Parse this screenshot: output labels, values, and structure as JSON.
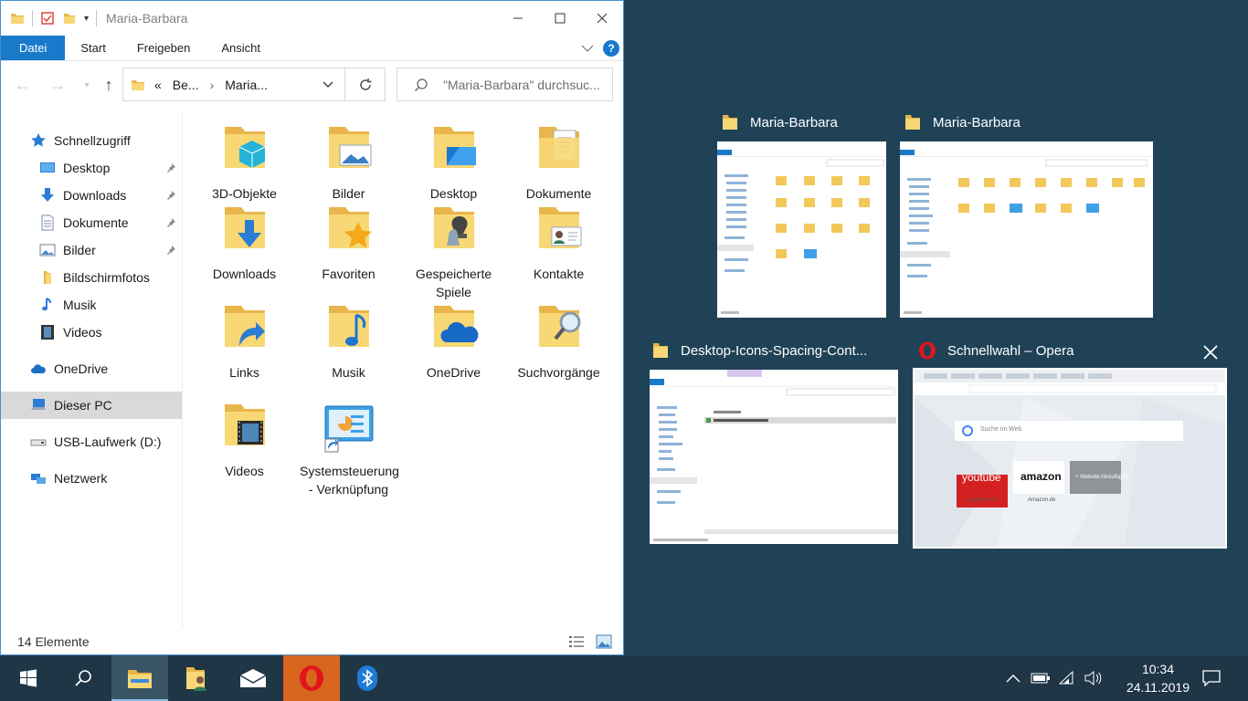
{
  "window": {
    "title": "Maria-Barbara",
    "ribbon_tabs": [
      "Datei",
      "Start",
      "Freigeben",
      "Ansicht"
    ],
    "address": {
      "prefix": "«",
      "crumb1": "Be...",
      "sep": "›",
      "crumb2": "Maria..."
    },
    "search_placeholder": "\"Maria-Barbara\" durchsuc...",
    "status": "14 Elemente"
  },
  "nav": [
    {
      "label": "Schnellzugriff",
      "icon": "star-icon",
      "level": 0
    },
    {
      "label": "Desktop",
      "icon": "desktop-icon",
      "level": 1,
      "pinned": true
    },
    {
      "label": "Downloads",
      "icon": "download-icon",
      "level": 1,
      "pinned": true
    },
    {
      "label": "Dokumente",
      "icon": "document-icon",
      "level": 1,
      "pinned": true
    },
    {
      "label": "Bilder",
      "icon": "pictures-icon",
      "level": 1,
      "pinned": true
    },
    {
      "label": "Bildschirmfotos",
      "icon": "folder-icon",
      "level": 1
    },
    {
      "label": "Musik",
      "icon": "music-icon",
      "level": 1
    },
    {
      "label": "Videos",
      "icon": "video-icon",
      "level": 1
    },
    {
      "label": "OneDrive",
      "icon": "cloud-icon",
      "level": 0
    },
    {
      "label": "Dieser PC",
      "icon": "pc-icon",
      "level": 0,
      "selected": true
    },
    {
      "label": "USB-Laufwerk (D:)",
      "icon": "usb-icon",
      "level": 0
    },
    {
      "label": "Netzwerk",
      "icon": "network-icon",
      "level": 0
    }
  ],
  "items": [
    {
      "label": "3D-Objekte",
      "icon": "3d-objects-icon"
    },
    {
      "label": "Bilder",
      "icon": "pictures-folder-icon"
    },
    {
      "label": "Desktop",
      "icon": "desktop-folder-icon"
    },
    {
      "label": "Dokumente",
      "icon": "documents-folder-icon"
    },
    {
      "label": "Downloads",
      "icon": "downloads-folder-icon"
    },
    {
      "label": "Favoriten",
      "icon": "favorites-folder-icon"
    },
    {
      "label": "Gespeicherte Spiele",
      "icon": "saved-games-folder-icon"
    },
    {
      "label": "Kontakte",
      "icon": "contacts-folder-icon"
    },
    {
      "label": "Links",
      "icon": "links-folder-icon"
    },
    {
      "label": "Musik",
      "icon": "music-folder-icon"
    },
    {
      "label": "OneDrive",
      "icon": "onedrive-folder-icon"
    },
    {
      "label": "Suchvorgänge",
      "icon": "searches-folder-icon"
    },
    {
      "label": "Videos",
      "icon": "videos-folder-icon"
    },
    {
      "label": "Systemsteuerung - Verknüpfung",
      "icon": "control-panel-shortcut-icon"
    }
  ],
  "snap": {
    "thumbs": [
      {
        "title": "Maria-Barbara",
        "icon": "folder-icon"
      },
      {
        "title": "Maria-Barbara",
        "icon": "folder-icon"
      },
      {
        "title": "Desktop-Icons-Spacing-Cont...",
        "icon": "folder-icon"
      },
      {
        "title": "Schnellwahl – Opera",
        "icon": "opera-icon"
      }
    ],
    "opera": {
      "search": "Suche im Web",
      "tile1": "youtube",
      "tile1_sub": "youtube.com",
      "tile2": "amazon",
      "tile2_sub": "Amazon.de",
      "tile3": "+ Website hinzufügen"
    }
  },
  "taskbar": {
    "time": "10:34",
    "date": "24.11.2019"
  },
  "colors": {
    "accent": "#1979ca",
    "desktop": "#1f4257",
    "taskbar": "#1e3646",
    "opera": "#d9661f"
  }
}
